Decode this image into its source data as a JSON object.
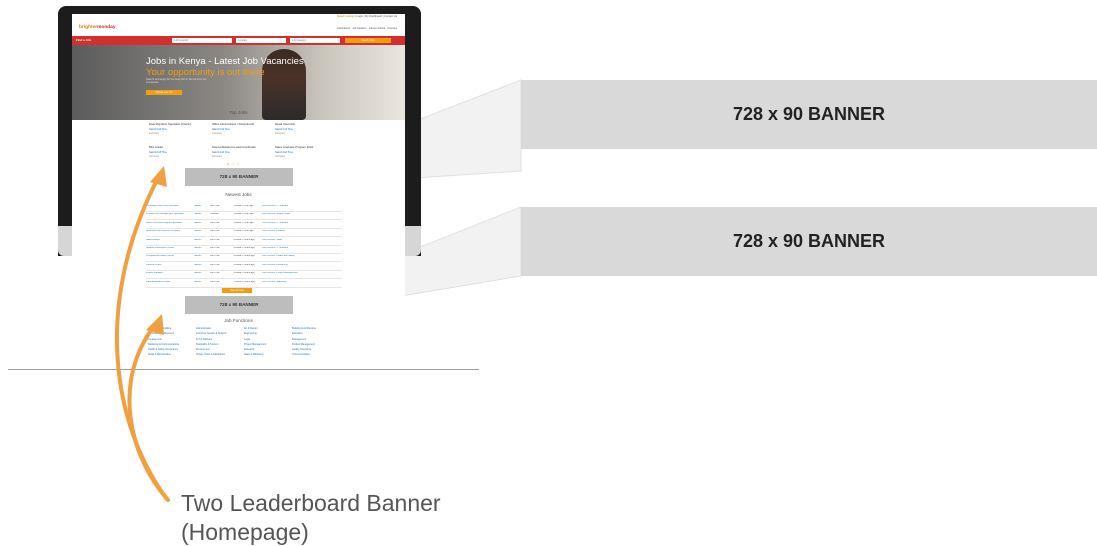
{
  "site": {
    "topbar_links": [
      "Search Listings",
      "Login",
      "My Dashboard",
      "Contact Us"
    ],
    "logo_main": "brighter",
    "logo_sub": "monday",
    "header_menu": [
      "Advertisers",
      "Job Seekers",
      "Career Advice",
      "Courses"
    ],
    "search": {
      "label": "Find a Job",
      "keyword_placeholder": "Job Keyword",
      "location_placeholder": "Location",
      "category_placeholder": "Job Category",
      "button": "Search Jobs"
    },
    "hero": {
      "title": "Jobs in Kenya - Latest Job Vacancies",
      "subtitle": "Your opportunity is out there",
      "text": "Search and apply for the best jobs in Kenya from top companies",
      "button": "Upload your CV"
    },
    "top_jobs": {
      "title": "Top Jobs",
      "cards": [
        {
          "title": "Data Migration Specialist (Oracle)",
          "meta": "Nairobi  Full Time",
          "date": "Company"
        },
        {
          "title": "Office Administrator / Receptionist",
          "meta": "Nairobi  Full Time",
          "date": "Company"
        },
        {
          "title": "Retail Internship",
          "meta": "Nairobi  Full Time",
          "date": "Company"
        },
        {
          "title": "Bird Guider",
          "meta": "Nairobi  Full Time",
          "date": "Company"
        },
        {
          "title": "Internal Relations Lead Coordinator",
          "meta": "Nairobi  Full Time",
          "date": "Company"
        },
        {
          "title": "Sales Graduate Program 2018",
          "meta": "Nairobi  Full Time",
          "date": "Company"
        }
      ]
    },
    "banner_label": "728 x 90 BANNER",
    "newest_jobs": {
      "title": "Newest Jobs",
      "rows": [
        {
          "title": "Information and Communication",
          "loc": "Nairobi",
          "type": "Full Time",
          "posted": "Posted: 1 hour ago",
          "more": "Job Function: IT Software"
        },
        {
          "title": "Procurement Management Specialist",
          "loc": "Nairobi",
          "type": "Contract",
          "posted": "Posted: 1 hour ago",
          "more": "Job Function: Supply Chain"
        },
        {
          "title": "Senior Technical Support Specialist",
          "loc": "Nairobi",
          "type": "Full Time",
          "posted": "Posted: 1 hour ago",
          "more": "Job Function: IT Software"
        },
        {
          "title": "Accountant at Kipsebei Company",
          "loc": "Nairobi",
          "type": "Full Time",
          "posted": "Posted: 1 hour ago",
          "more": "Job Function: Finance"
        },
        {
          "title": "Sales Analyst",
          "loc": "Nairobi",
          "type": "Full Time",
          "posted": "Posted: 2 hours ago",
          "more": "Job Function: Sales"
        },
        {
          "title": "Network Developers Officer",
          "loc": "Nairobi",
          "type": "Full Time",
          "posted": "Posted: 2 hours ago",
          "more": "Job Function: IT Software"
        },
        {
          "title": "Occupational Safety Officer",
          "loc": "Nairobi",
          "type": "Full Time",
          "posted": "Posted: 2 hours ago",
          "more": "Job Function: Health and Safety"
        },
        {
          "title": "Finance Officer",
          "loc": "Nairobi",
          "type": "Full Time",
          "posted": "Posted: 2 hours ago",
          "more": "Job Function: Accounting"
        },
        {
          "title": "Project Manager",
          "loc": "Nairobi",
          "type": "Full Time",
          "posted": "Posted: 3 hours ago",
          "more": "Job Function: Project Management"
        },
        {
          "title": "Internal Relations Lead",
          "loc": "Nairobi",
          "type": "Full Time",
          "posted": "Posted: 3 hours ago",
          "more": "Job Function: Marketing"
        }
      ],
      "view_all": "View All Jobs"
    },
    "job_functions": {
      "title": "Job Functions",
      "columns": [
        [
          "Accounting & Auditing",
          "Consultancy & Business",
          "Creative Arts",
          "Marketing & Communications",
          "Health & Safety & Insurance",
          "Retail & Merchandise"
        ],
        [
          "Administration",
          "Customer Service & Support",
          "ICT & Software",
          "Hospitality & Tourism",
          "Procurement",
          "Supply Chain & Distribution"
        ],
        [
          "Art & Design",
          "Engineering",
          "Legal",
          "Project Management",
          "Research",
          "Sales & Marketing"
        ],
        [
          "Building & Architecture",
          "Education",
          "Management",
          "Product Management",
          "Quality Assurance",
          "Travel & Aviation"
        ]
      ]
    }
  },
  "banners": [
    {
      "label": "728 x 90 BANNER"
    },
    {
      "label": "728 x 90 BANNER"
    }
  ],
  "caption": {
    "line1": "Two Leaderboard Banner",
    "line2": "(Homepage)"
  },
  "colors": {
    "accent_arrow": "#f0a040",
    "brand_red": "#d32f2f",
    "brand_orange": "#f39c12",
    "banner_gray": "#d9d9d9"
  }
}
